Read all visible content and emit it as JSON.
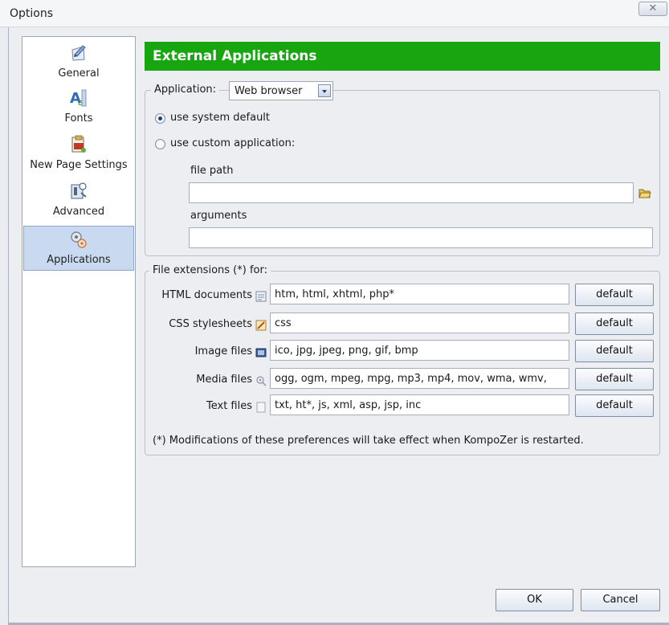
{
  "window": {
    "title": "Options",
    "close_glyph": "✕"
  },
  "sidebar": {
    "items": [
      {
        "label": "General",
        "icon": "general-icon"
      },
      {
        "label": "Fonts",
        "icon": "fonts-icon"
      },
      {
        "label": "New Page Settings",
        "icon": "new-page-settings-icon"
      },
      {
        "label": "Advanced",
        "icon": "advanced-icon"
      },
      {
        "label": "Applications",
        "icon": "applications-icon",
        "selected": true
      }
    ]
  },
  "panel": {
    "title": "External Applications",
    "header_color": "#17a610",
    "application": {
      "label": "Application:",
      "selected": "Web browser",
      "radio_system": "use system default",
      "radio_custom": "use custom application:",
      "selected_radio": "use system default",
      "file_path_label": "file path",
      "file_path_value": "",
      "arguments_label": "arguments",
      "arguments_value": ""
    },
    "extensions": {
      "legend": "File extensions (*) for:",
      "rows": [
        {
          "label": "HTML documents",
          "value": "htm, html, xhtml, php*",
          "button": "default"
        },
        {
          "label": "CSS stylesheets",
          "value": "css",
          "button": "default"
        },
        {
          "label": "Image files",
          "value": "ico, jpg, jpeg, png, gif, bmp",
          "button": "default"
        },
        {
          "label": "Media files",
          "value": "ogg, ogm, mpeg, mpg, mp3, mp4, mov, wma, wmv,",
          "button": "default"
        },
        {
          "label": "Text files",
          "value": "txt, ht*, js, xml, asp, jsp, inc",
          "button": "default"
        }
      ],
      "note": "(*) Modifications of these preferences will take effect when KompoZer is restarted."
    }
  },
  "footer": {
    "ok": "OK",
    "cancel": "Cancel"
  }
}
